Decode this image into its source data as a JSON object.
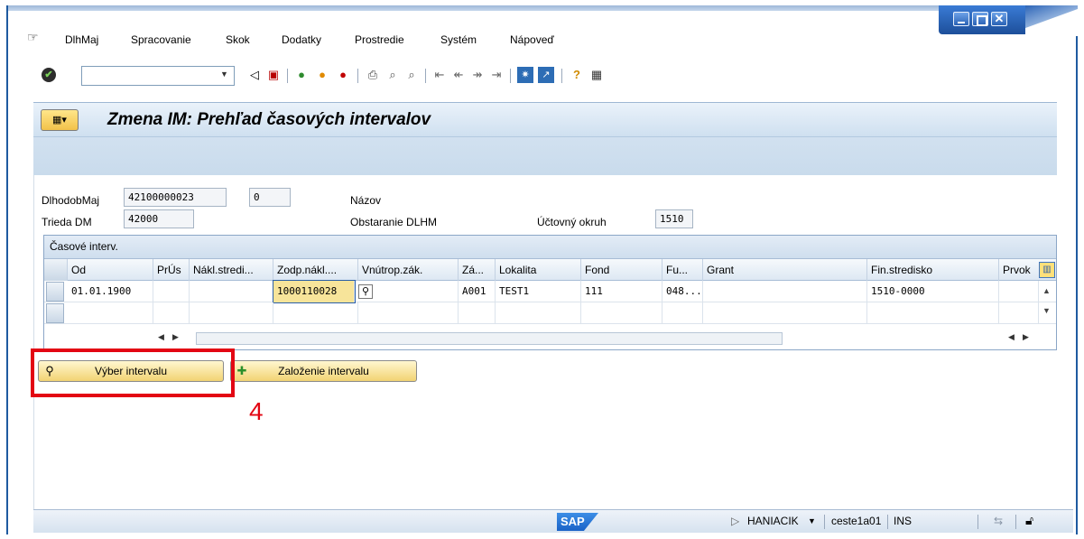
{
  "menubar": {
    "items": [
      "DlhMaj",
      "Spracovanie",
      "Skok",
      "Dodatky",
      "Prostredie",
      "Systém",
      "Nápoveď"
    ]
  },
  "toolbar": {
    "command_value": "",
    "icons": [
      "back-icon",
      "save-icon",
      "exit-icon",
      "cancel-icon",
      "print-icon",
      "find-icon",
      "find-next-icon",
      "first-page-icon",
      "prev-page-icon",
      "next-page-icon",
      "last-page-icon",
      "new-session-icon",
      "shortcut-icon",
      "help-icon",
      "customize-layout-icon"
    ]
  },
  "header": {
    "title": "Zmena IM: Prehľad časových intervalov"
  },
  "form": {
    "dlhodobmaj_label": "DlhodobMaj",
    "dlhodobmaj_value": "42100000023",
    "subnumber_value": "0",
    "nazov_label": "Názov",
    "trieda_label": "Trieda DM",
    "trieda_value": "42000",
    "trieda_desc": "Obstaranie DLHM",
    "okruh_label": "Účtovný okruh",
    "okruh_value": "1510"
  },
  "table": {
    "caption": "Časové interv.",
    "columns": [
      "Od",
      "PrÚs",
      "Nákl.stredi...",
      "Zodp.nákl....",
      "Vnútrop.zák.",
      "Zá...",
      "Lokalita",
      "Fond",
      "Fu...",
      "Grant",
      "Fin.stredisko",
      "Prvok"
    ],
    "rows": [
      [
        "01.01.1900",
        "",
        "",
        "1000110028",
        "",
        "A001",
        "TEST1",
        "111",
        "048...",
        "",
        "1510-0000",
        ""
      ],
      [
        "",
        "",
        "",
        "",
        "",
        "",
        "",
        "",
        "",
        "",
        "",
        ""
      ]
    ]
  },
  "buttons": {
    "vyber": "Výber intervalu",
    "zalozenie": "Založenie intervalu"
  },
  "annotation": {
    "step": "4"
  },
  "status": {
    "logo": "SAP",
    "user": "HANIACIK",
    "server": "ceste1a01",
    "mode": "INS"
  }
}
